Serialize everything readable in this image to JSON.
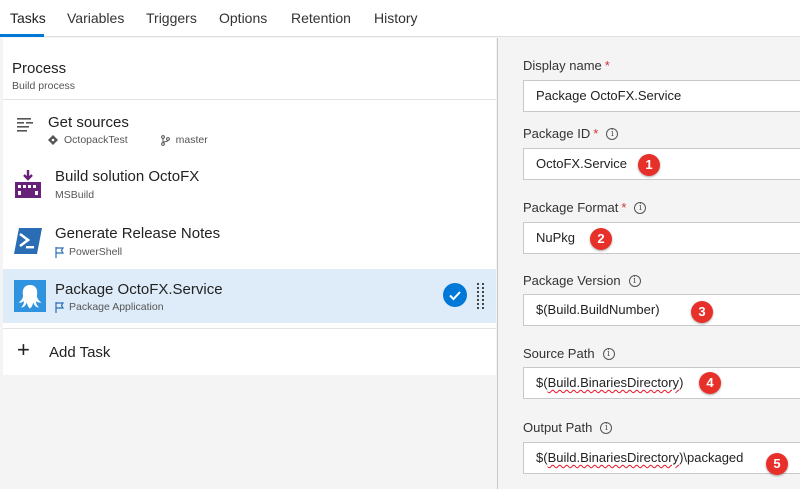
{
  "tabs": [
    {
      "label": "Tasks",
      "active": true
    },
    {
      "label": "Variables"
    },
    {
      "label": "Triggers"
    },
    {
      "label": "Options"
    },
    {
      "label": "Retention"
    },
    {
      "label": "History"
    }
  ],
  "process": {
    "title": "Process",
    "subtitle": "Build process"
  },
  "tasks": [
    {
      "title": "Get sources",
      "repo": "OctopackTest",
      "branch": "master",
      "icon": "get-sources-icon"
    },
    {
      "title": "Build solution OctoFX",
      "subtitle": "MSBuild",
      "icon": "msbuild-icon"
    },
    {
      "title": "Generate Release Notes",
      "subtitle": "PowerShell",
      "icon": "powershell-icon"
    },
    {
      "title": "Package OctoFX.Service",
      "subtitle": "Package Application",
      "icon": "octopus-icon",
      "selected": true
    }
  ],
  "add_task": {
    "label": "Add Task"
  },
  "fields": {
    "display_name": {
      "label": "Display name",
      "value": "Package OctoFX.Service"
    },
    "package_id": {
      "label": "Package ID",
      "value": "OctoFX.Service",
      "badge": "1"
    },
    "package_format": {
      "label": "Package Format",
      "value": "NuPkg",
      "badge": "2"
    },
    "package_version": {
      "label": "Package Version",
      "value": "$(Build.BuildNumber)",
      "badge": "3"
    },
    "source_path": {
      "label": "Source Path",
      "value_prefix": "$(",
      "value_underlined": "Build.BinariesDirectory",
      "value_suffix": ")",
      "badge": "4"
    },
    "output_path": {
      "label": "Output Path",
      "value_prefix": "$(",
      "value_underlined": "Build.BinariesDirectory",
      "value_suffix": ")\\packaged",
      "badge": "5"
    }
  },
  "colors": {
    "accent": "#0078d7",
    "required": "#d13438",
    "badge": "#e8302b",
    "selected_row": "#deecf9"
  }
}
